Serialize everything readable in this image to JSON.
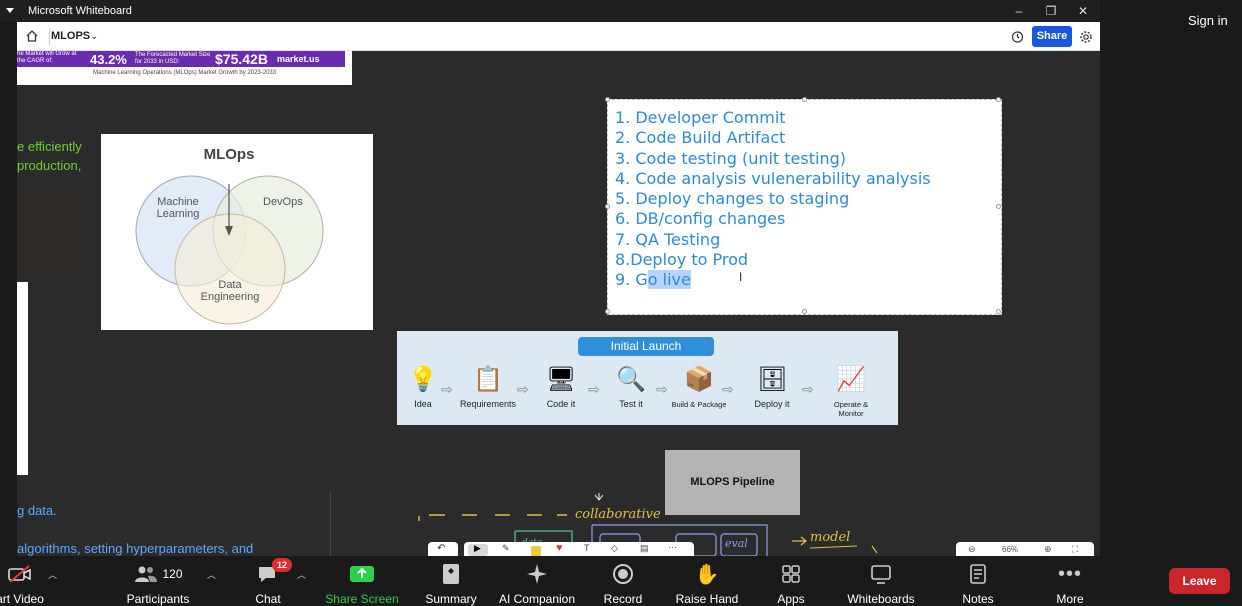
{
  "window": {
    "title": "Microsoft Whiteboard"
  },
  "account": {
    "signin_label": "Sign in"
  },
  "whiteboard": {
    "board_name": "MLOPS",
    "share_label": "Share",
    "banner": {
      "text1": "he Market will Grow at the CAGR of:",
      "value1": "43.2%",
      "text2": "The Forecasted Market Size for 2033 in USD:",
      "value2": "$75.42B",
      "brand": "market.us",
      "caption": "Machine Learning Operations (MLOps) Market Growth by 2023-2033"
    },
    "left_texts": {
      "green_line1": "e efficiently",
      "green_line2": "production,",
      "blue_line1": "g data.",
      "blue_line2": "algorithms, setting hyperparameters, and"
    },
    "venn": {
      "title": "MLOps",
      "circle1": "Machine Learning",
      "circle2": "DevOps",
      "circle3": "Data Engineering"
    },
    "steps": [
      "1. Developer Commit",
      "2. Code Build Artifact",
      "3. Code testing (unit testing)",
      "4. Code analysis vulenerability analysis",
      "5. Deploy changes to staging",
      "6. DB/config changes",
      "7. QA Testing",
      "8.Deploy to Prod"
    ],
    "step9_prefix": "9. G",
    "step9_selected": "o live",
    "launch": {
      "title": "Initial Launch",
      "stages": [
        "Idea",
        "Requirements",
        "Code it",
        "Test it",
        "Build & Package",
        "Deploy it",
        "Operate & Monitor"
      ]
    },
    "pipeline_label": "MLOPS Pipeline",
    "sketch": {
      "word1": "collaborative",
      "word2": "model",
      "word3": "eval",
      "word4": "data"
    },
    "zoom_level": "66%"
  },
  "meeting_toolbar": {
    "video_label": "art Video",
    "participants_label": "Participants",
    "participants_count": "120",
    "chat_label": "Chat",
    "chat_badge": "12",
    "share_screen_label": "Share Screen",
    "summary_label": "Summary",
    "ai_label": "AI Companion",
    "record_label": "Record",
    "raise_hand_label": "Raise Hand",
    "apps_label": "Apps",
    "whiteboards_label": "Whiteboards",
    "notes_label": "Notes",
    "more_label": "More",
    "leave_label": "Leave"
  },
  "colors": {
    "share_blue": "#1a56db",
    "leave_red": "#c9262b",
    "share_screen_green": "#2ad14c",
    "step_blue": "#2d8ad8"
  }
}
